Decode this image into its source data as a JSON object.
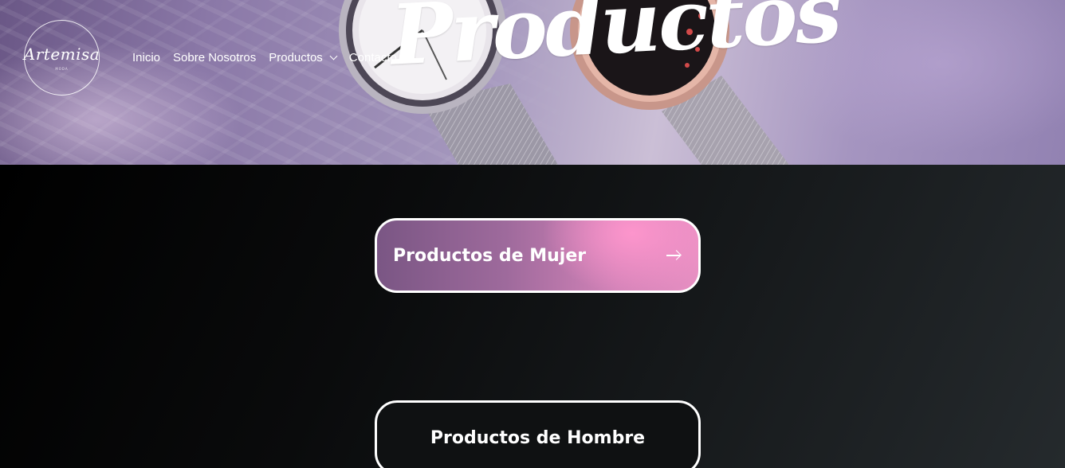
{
  "brand": {
    "logo_text": "Artemisa",
    "logo_subtext": "MODA"
  },
  "nav": {
    "items": [
      {
        "label": "Inicio"
      },
      {
        "label": "Sobre Nosotros"
      },
      {
        "label": "Productos",
        "has_dropdown": true
      },
      {
        "label": "Contacto"
      }
    ]
  },
  "hero": {
    "title": "Productos"
  },
  "categories": [
    {
      "label": "Productos de Mujer",
      "icon": "arrow-right-icon"
    },
    {
      "label": "Productos de Hombre"
    }
  ],
  "colors": {
    "women_gradient_start": "#7a5684",
    "women_gradient_end": "#e78fc2",
    "hero_tint": "#9282b2",
    "background_dark": "#0a0b0c"
  }
}
